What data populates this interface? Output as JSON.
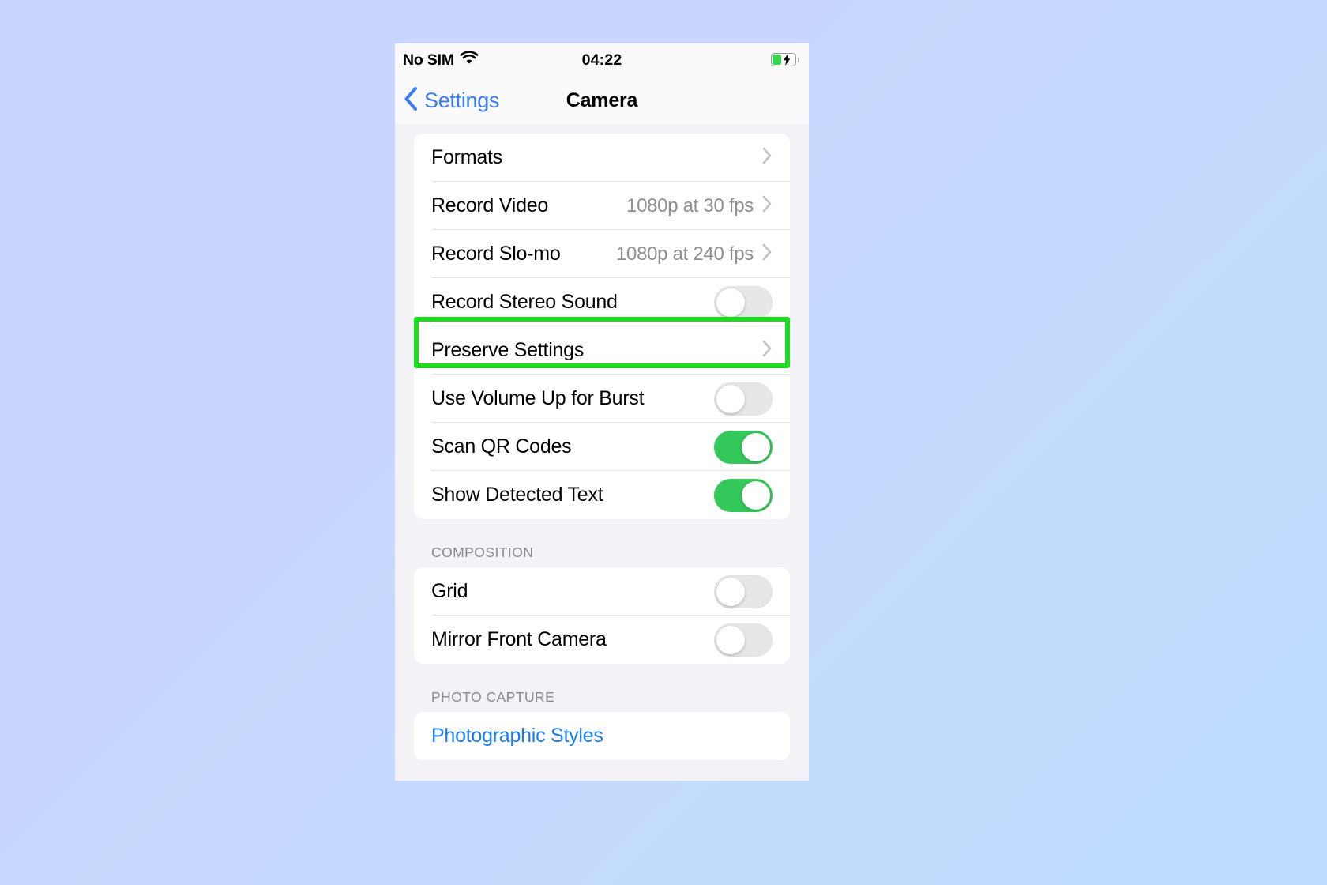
{
  "statusbar": {
    "carrier": "No SIM",
    "time": "04:22",
    "wifi_icon": "wifi-icon",
    "battery_icon": "battery-charging-icon"
  },
  "navbar": {
    "back_label": "Settings",
    "back_icon": "chevron-left-icon",
    "title": "Camera"
  },
  "sections": [
    {
      "header": "",
      "rows": [
        {
          "label": "Formats",
          "type": "disclosure",
          "value": ""
        },
        {
          "label": "Record Video",
          "type": "disclosure",
          "value": "1080p at 30 fps"
        },
        {
          "label": "Record Slo-mo",
          "type": "disclosure",
          "value": "1080p at 240 fps"
        },
        {
          "label": "Record Stereo Sound",
          "type": "toggle",
          "state": "off",
          "highlighted": true
        },
        {
          "label": "Preserve Settings",
          "type": "disclosure",
          "value": ""
        },
        {
          "label": "Use Volume Up for Burst",
          "type": "toggle",
          "state": "off"
        },
        {
          "label": "Scan QR Codes",
          "type": "toggle",
          "state": "on"
        },
        {
          "label": "Show Detected Text",
          "type": "toggle",
          "state": "on"
        }
      ]
    },
    {
      "header": "COMPOSITION",
      "rows": [
        {
          "label": "Grid",
          "type": "toggle",
          "state": "off"
        },
        {
          "label": "Mirror Front Camera",
          "type": "toggle",
          "state": "off"
        }
      ]
    },
    {
      "header": "PHOTO CAPTURE",
      "rows": [
        {
          "label": "Photographic Styles",
          "type": "link"
        }
      ]
    }
  ],
  "colors": {
    "accent_blue": "#1b7cf0",
    "toggle_on_green": "#34c759",
    "highlight_green": "#1ddb1d",
    "background_start": "#c9d3fd",
    "background_end": "#bfdcfe"
  }
}
